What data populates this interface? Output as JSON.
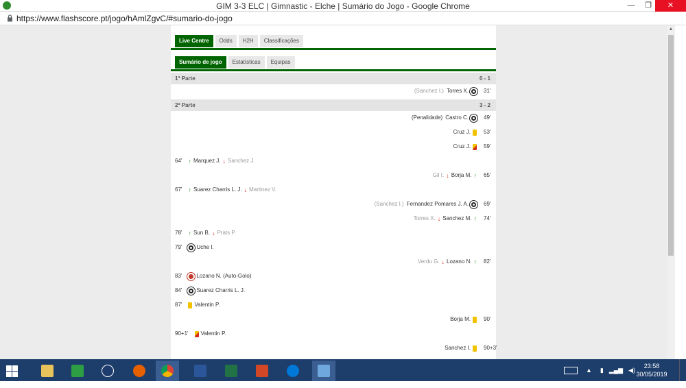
{
  "window": {
    "title": "GIM 3-3 ELC | Gimnastic - Elche | Sumário do Jogo - Google Chrome",
    "minimize": "—",
    "maximize": "❐",
    "close": "✕"
  },
  "address": {
    "url": "https://www.flashscore.pt/jogo/hAmlZgvC/#sumario-do-jogo"
  },
  "tabs": [
    {
      "label": "Live Centre",
      "active": true
    },
    {
      "label": "Odds",
      "active": false
    },
    {
      "label": "H2H",
      "active": false
    },
    {
      "label": "Classificações",
      "active": false
    }
  ],
  "subtabs": [
    {
      "label": "Sumário de jogo",
      "active": true
    },
    {
      "label": "Estatísticas",
      "active": false
    },
    {
      "label": "Equipas",
      "active": false
    }
  ],
  "first_half": {
    "name": "1ª Parte",
    "score": "0 - 1",
    "events": [
      {
        "side": "right",
        "minute": "31'",
        "type": "goal",
        "player": "Torres X.",
        "detail": "(Sanchez I.)"
      }
    ]
  },
  "second_half": {
    "name": "2ª Parte",
    "score": "3 - 2",
    "events": [
      {
        "side": "right",
        "minute": "49'",
        "type": "goal",
        "player": "Castro C.",
        "detail": "(Penalidade)"
      },
      {
        "side": "right",
        "minute": "53'",
        "type": "yellow",
        "player": "Cruz J."
      },
      {
        "side": "right",
        "minute": "59'",
        "type": "yellowred",
        "player": "Cruz J."
      },
      {
        "side": "left",
        "minute": "64'",
        "type": "sub",
        "player_in": "Marquez J.",
        "player_out": "Sanchez J."
      },
      {
        "side": "right",
        "minute": "65'",
        "type": "sub",
        "player_in": "Borja M.",
        "player_out": "Gil I."
      },
      {
        "side": "left",
        "minute": "67'",
        "type": "sub",
        "player_in": "Suarez Charris L. J.",
        "player_out": "Martinez V."
      },
      {
        "side": "right",
        "minute": "69'",
        "type": "goal",
        "player": "Fernandez Pomares J. A.",
        "detail": "(Sanchez I.)"
      },
      {
        "side": "right",
        "minute": "74'",
        "type": "sub",
        "player_in": "Sanchez M.",
        "player_out": "Torres X."
      },
      {
        "side": "left",
        "minute": "78'",
        "type": "sub",
        "player_in": "Sun B.",
        "player_out": "Prats P."
      },
      {
        "side": "left",
        "minute": "79'",
        "type": "goal",
        "player": "Uche I."
      },
      {
        "side": "right",
        "minute": "82'",
        "type": "sub",
        "player_in": "Lozano N.",
        "player_out": "Verdu G."
      },
      {
        "side": "left",
        "minute": "83'",
        "type": "owngoal",
        "player": "Lozano N. (Auto-Golo)"
      },
      {
        "side": "left",
        "minute": "84'",
        "type": "goal",
        "player": "Suarez Charris L. J."
      },
      {
        "side": "left",
        "minute": "87'",
        "type": "yellow",
        "player": "Valentin P."
      },
      {
        "side": "right",
        "minute": "90'",
        "type": "yellow",
        "player": "Borja M."
      },
      {
        "side": "left",
        "minute": "90+1'",
        "type": "yellowred",
        "player": "Valentin P."
      },
      {
        "side": "right",
        "minute": "90+3'",
        "type": "yellow",
        "player": "Sanchez I."
      }
    ]
  },
  "taskbar": {
    "apps": [
      "start-icon",
      "file-explorer-icon",
      "store-icon",
      "help-icon",
      "firefox-icon",
      "chrome-icon",
      "word-icon",
      "excel-icon",
      "powerpoint-icon",
      "edge-icon",
      "remote-desktop-icon"
    ],
    "time": "23:58",
    "date": "30/05/2019",
    "colors": {
      "taskbar": "#1d3d6a",
      "accent_green": "#006400"
    }
  }
}
